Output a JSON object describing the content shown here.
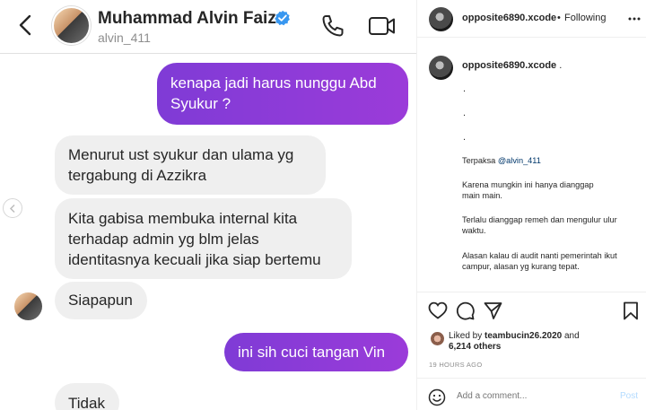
{
  "dm": {
    "name": "Muhammad Alvin Faiz",
    "handle": "alvin_411",
    "messages": [
      {
        "side": "out",
        "lines": [
          "kenapa jadi harus nunggu Abd",
          "Syukur ?"
        ]
      },
      {
        "side": "in",
        "lines": [
          "Menurut ust syukur dan ulama yg",
          "tergabung di Azzikra"
        ]
      },
      {
        "side": "in",
        "lines": [
          "Kita gabisa membuka internal kita",
          "terhadap admin yg blm jelas",
          "identitasnya kecuali jika siap bertemu"
        ]
      },
      {
        "side": "in",
        "lines": [
          "Siapapun"
        ]
      },
      {
        "side": "out",
        "lines": [
          "ini sih cuci tangan Vin"
        ]
      },
      {
        "side": "in",
        "lines": [
          "Tidak"
        ]
      }
    ],
    "colors": {
      "outgoing_bubble": "#8a3bd9",
      "incoming_bubble": "#efefef",
      "verified": "#3897f0"
    }
  },
  "post": {
    "header": {
      "username": "opposite6890.xcode",
      "separator": "•",
      "follow_label": "Following"
    },
    "caption": {
      "username": "opposite6890.xcode",
      "username_suffix": " .",
      "dots": [
        ".",
        ".",
        "."
      ],
      "lines": [
        {
          "prefix": "Terpaksa ",
          "mention": "@alvin_411"
        },
        {
          "text": "Karena mungkin ini hanya dianggap main main."
        },
        {
          "text": "Terlalu dianggap remeh dan mengulur ulur waktu."
        },
        {
          "text": "Alasan kalau di audit nanti pemerintah ikut campur, alasan yg kurang tepat."
        }
      ]
    },
    "likes": {
      "prefix": "Liked by ",
      "user": "teambucin26.2020",
      "mid": " and ",
      "count": "6,214 others"
    },
    "timestamp": "19 HOURS AGO",
    "comment": {
      "placeholder": "Add a comment...",
      "post_label": "Post"
    },
    "colors": {
      "mention": "#00376b",
      "post_button": "#b3dbff"
    }
  }
}
